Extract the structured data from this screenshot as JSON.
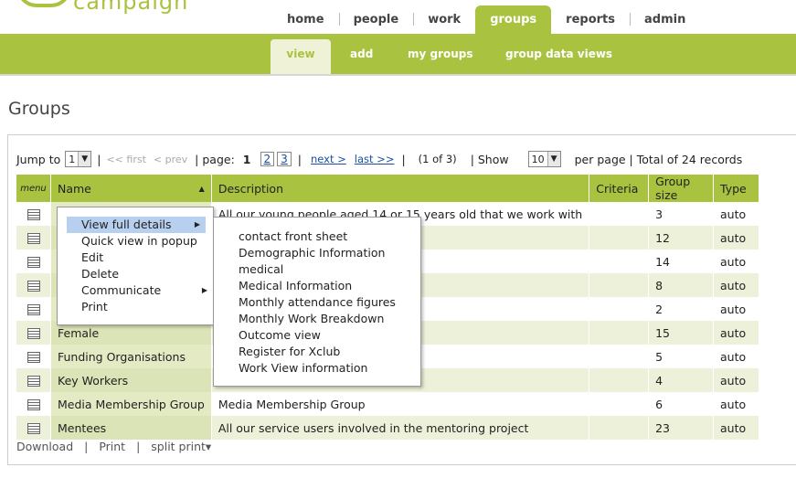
{
  "brand": {
    "accent": "#a9c23f",
    "logo_text": "campaign"
  },
  "topnav": [
    {
      "label": "home"
    },
    {
      "label": "people"
    },
    {
      "label": "work"
    },
    {
      "label": "groups",
      "active": true
    },
    {
      "label": "reports"
    },
    {
      "label": "admin"
    }
  ],
  "subnav": [
    {
      "label": "view",
      "active": true
    },
    {
      "label": "add"
    },
    {
      "label": "my groups"
    },
    {
      "label": "group data views"
    }
  ],
  "page_title": "Groups",
  "pager": {
    "jump_to_label": "Jump to",
    "jump_to_value": "1",
    "first": "<< first",
    "prev": "< prev",
    "page_label": "| page:",
    "current_page": "1",
    "pages": [
      "2",
      "3"
    ],
    "next": "next >",
    "last": "last >>",
    "position": "(1 of 3)",
    "show_label": "| Show",
    "show_value": "10",
    "per_page_text": "per page | Total of 24 records"
  },
  "table": {
    "headers": {
      "menu": "menu",
      "name": "Name",
      "description": "Description",
      "criteria": "Criteria",
      "size": "Group size",
      "type": "Type"
    },
    "rows": [
      {
        "name": "",
        "description": "All our young people aged 14 or 15 years old that we work with",
        "criteria": "",
        "size": "3",
        "type": "auto"
      },
      {
        "name": "",
        "description": "",
        "criteria": "",
        "size": "12",
        "type": "auto"
      },
      {
        "name": "",
        "description": "",
        "criteria": "",
        "size": "14",
        "type": "auto"
      },
      {
        "name": "",
        "description": "",
        "criteria": "",
        "size": "8",
        "type": "auto"
      },
      {
        "name": "",
        "description": "",
        "criteria": "",
        "size": "2",
        "type": "auto"
      },
      {
        "name": "Female",
        "description": "",
        "criteria": "",
        "size": "15",
        "type": "auto"
      },
      {
        "name": "Funding Organisations",
        "description": "",
        "criteria": "",
        "size": "5",
        "type": "auto"
      },
      {
        "name": "Key Workers",
        "description": "",
        "criteria": "",
        "size": "4",
        "type": "auto"
      },
      {
        "name": "Media Membership Group",
        "description": "Media Membership Group",
        "criteria": "",
        "size": "6",
        "type": "auto"
      },
      {
        "name": "Mentees",
        "description": "All our service users involved in the mentoring project",
        "criteria": "",
        "size": "23",
        "type": "auto"
      }
    ]
  },
  "footer": {
    "download": "Download",
    "print": "Print",
    "split_print": "split print▾"
  },
  "context_menu": {
    "items": [
      {
        "label": "View full details",
        "highlighted": true,
        "submenu": true
      },
      {
        "label": "Quick view in popup"
      },
      {
        "label": "Edit"
      },
      {
        "label": "Delete"
      },
      {
        "label": "Communicate",
        "submenu": true
      },
      {
        "label": "Print"
      }
    ],
    "submenu_items": [
      "contact front sheet",
      "Demographic Information",
      "medical",
      "Medical Information",
      "Monthly attendance figures",
      "Monthly Work Breakdown",
      "Outcome view",
      "Register for Xclub",
      "Work View information"
    ]
  }
}
